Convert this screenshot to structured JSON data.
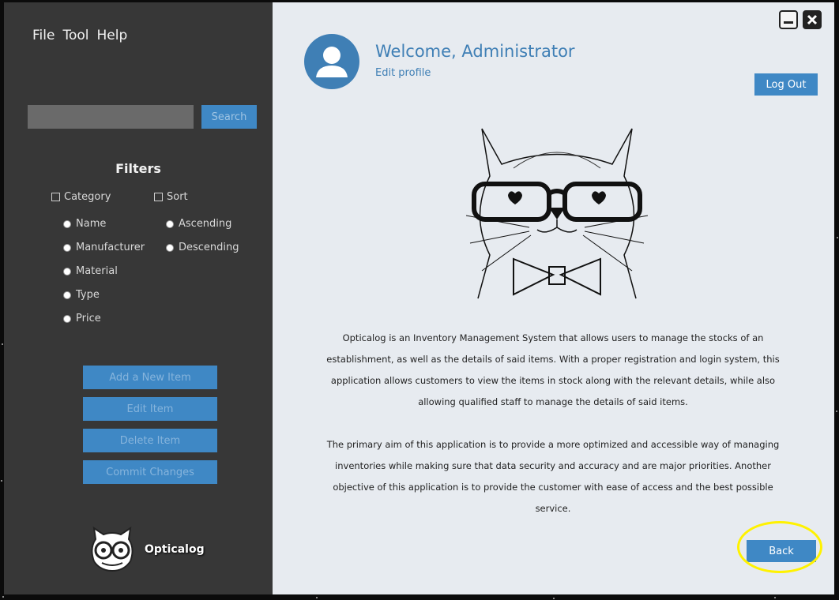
{
  "menu": {
    "file": "File",
    "tool": "Tool",
    "help": "Help"
  },
  "search": {
    "placeholder": "",
    "button": "Search"
  },
  "filters": {
    "title": "Filters",
    "category_label": "Category",
    "sort_label": "Sort",
    "category_options": [
      "Name",
      "Manufacturer",
      "Material",
      "Type",
      "Price"
    ],
    "sort_options": [
      "Ascending",
      "Descending"
    ]
  },
  "actions": {
    "add": "Add a New Item",
    "edit": "Edit Item",
    "delete": "Delete Item",
    "commit": "Commit Changes"
  },
  "logo": {
    "text": "Opticalog"
  },
  "header": {
    "welcome": "Welcome, Administrator",
    "edit_profile": "Edit profile",
    "logout": "Log Out"
  },
  "about": {
    "para1": "Opticalog is an Inventory Management System that allows users to manage the stocks of an establishment, as well as the details of said items. With a proper registration and login system, this application allows customers to view the items in stock along with the relevant details, while also allowing qualified staff to manage the details of said items.",
    "para2": "The primary aim of this application is to provide a more optimized and accessible way of managing inventories while making sure that data security and accuracy and are major priorities. Another objective of this application is to provide the customer with ease of access and the best possible service."
  },
  "back": "Back",
  "colors": {
    "accent": "#3f88c5",
    "sidebar": "#373737",
    "main": "#e7ebf0",
    "highlight": "#fff200"
  }
}
